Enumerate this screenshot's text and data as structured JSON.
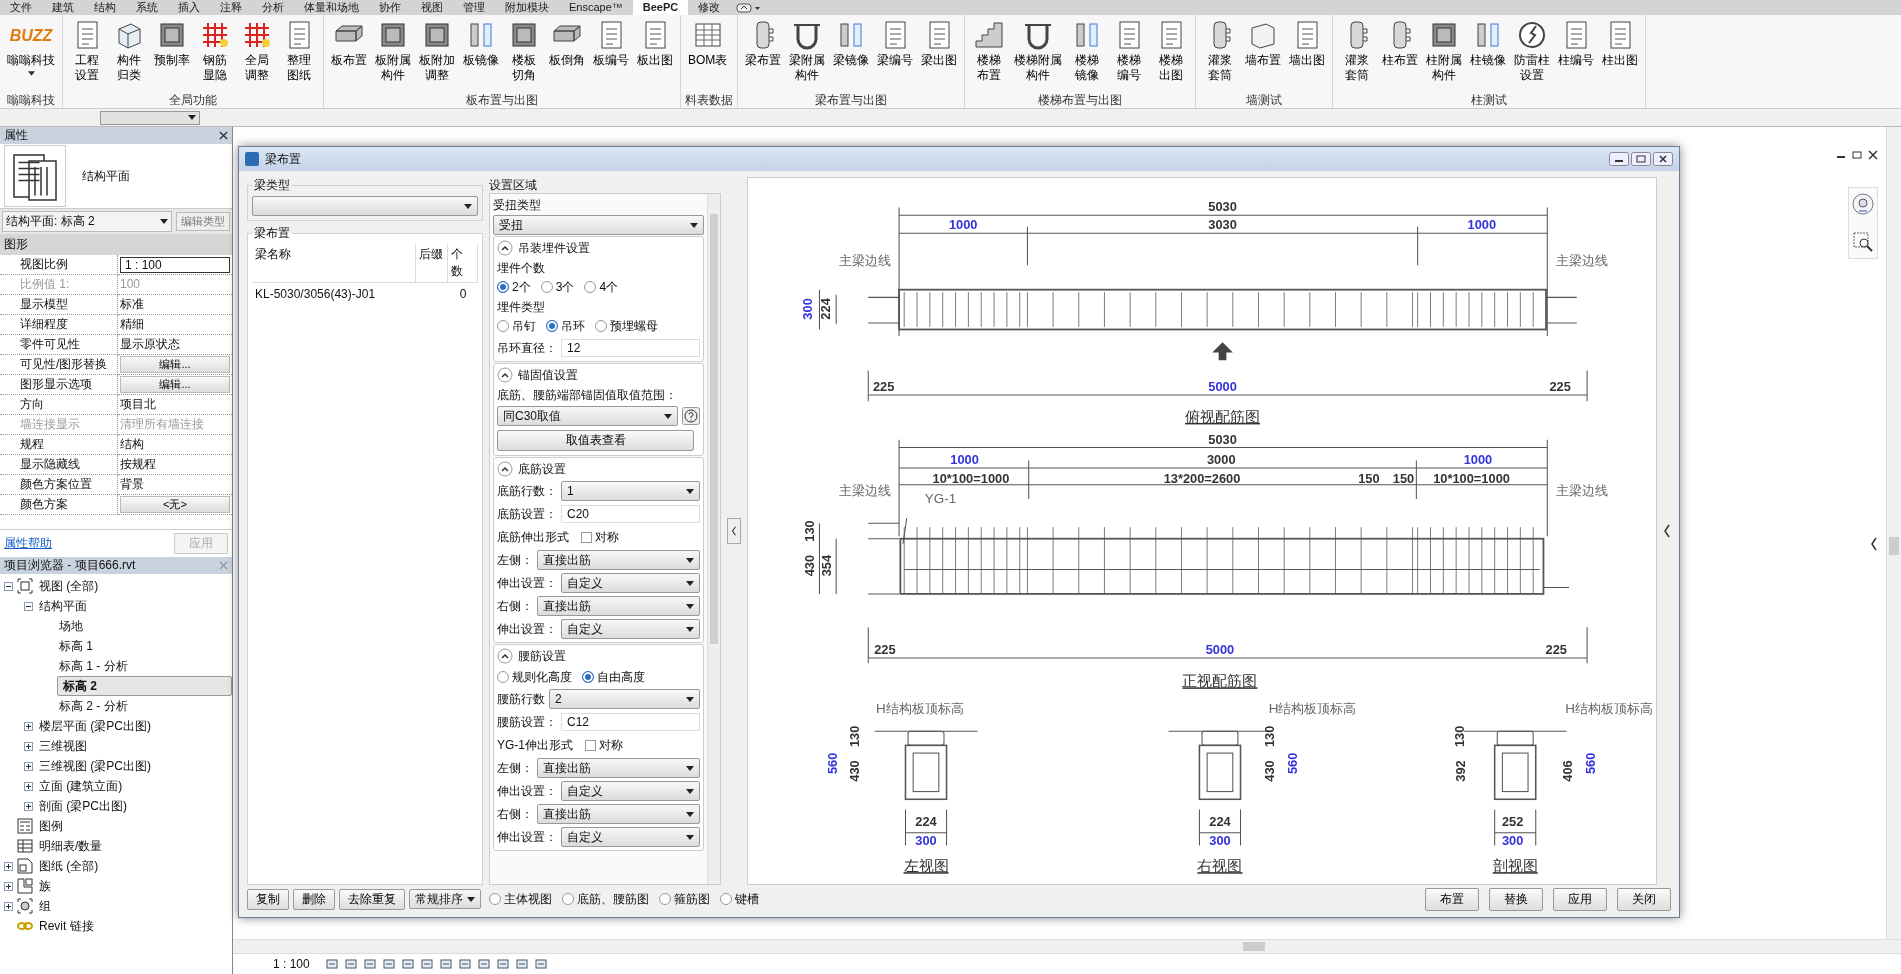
{
  "tabs": [
    {
      "label": "文件",
      "selected": false
    },
    {
      "label": "建筑",
      "selected": false
    },
    {
      "label": "结构",
      "selected": false
    },
    {
      "label": "系统",
      "selected": false
    },
    {
      "label": "插入",
      "selected": false
    },
    {
      "label": "注释",
      "selected": false
    },
    {
      "label": "分析",
      "selected": false
    },
    {
      "label": "体量和场地",
      "selected": false
    },
    {
      "label": "协作",
      "selected": false
    },
    {
      "label": "视图",
      "selected": false
    },
    {
      "label": "管理",
      "selected": false
    },
    {
      "label": "附加模块",
      "selected": false
    },
    {
      "label": "Enscape™",
      "selected": false
    },
    {
      "label": "BeePC",
      "selected": true
    },
    {
      "label": "修改",
      "selected": false
    }
  ],
  "ribbon": {
    "groups": [
      {
        "label": "嗡嗡科技",
        "buttons": [
          {
            "lines": [
              "嗡嗡科技"
            ],
            "logo": "BUZZ"
          }
        ]
      },
      {
        "label": "全局功能",
        "buttons": [
          {
            "lines": [
              "工程",
              "设置"
            ]
          },
          {
            "lines": [
              "构件",
              "归类"
            ]
          },
          {
            "lines": [
              "预制率"
            ]
          },
          {
            "lines": [
              "钢筋",
              "显隐"
            ]
          },
          {
            "lines": [
              "全局",
              "调整"
            ]
          },
          {
            "lines": [
              "整理",
              "图纸"
            ]
          }
        ]
      },
      {
        "label": "板布置与出图",
        "buttons": [
          {
            "lines": [
              "板布置"
            ]
          },
          {
            "lines": [
              "板附属",
              "构件"
            ]
          },
          {
            "lines": [
              "板附加",
              "调整"
            ]
          },
          {
            "lines": [
              "板镜像"
            ]
          },
          {
            "lines": [
              "楼板",
              "切角"
            ]
          },
          {
            "lines": [
              "板倒角"
            ]
          },
          {
            "lines": [
              "板编号"
            ]
          },
          {
            "lines": [
              "板出图"
            ]
          }
        ]
      },
      {
        "label": "料表数据",
        "buttons": [
          {
            "lines": [
              "BOM表"
            ]
          }
        ]
      },
      {
        "label": "梁布置与出图",
        "buttons": [
          {
            "lines": [
              "梁布置"
            ]
          },
          {
            "lines": [
              "梁附属",
              "构件"
            ]
          },
          {
            "lines": [
              "梁镜像"
            ]
          },
          {
            "lines": [
              "梁编号"
            ]
          },
          {
            "lines": [
              "梁出图"
            ]
          }
        ]
      },
      {
        "label": "楼梯布置与出图",
        "buttons": [
          {
            "lines": [
              "楼梯",
              "布置"
            ]
          },
          {
            "lines": [
              "楼梯附属",
              "构件"
            ]
          },
          {
            "lines": [
              "楼梯",
              "镜像"
            ]
          },
          {
            "lines": [
              "楼梯",
              "编号"
            ]
          },
          {
            "lines": [
              "楼梯",
              "出图"
            ]
          }
        ]
      },
      {
        "label": "墙测试",
        "buttons": [
          {
            "lines": [
              "灌浆",
              "套筒"
            ]
          },
          {
            "lines": [
              "墙布置"
            ]
          },
          {
            "lines": [
              "墙出图"
            ]
          }
        ]
      },
      {
        "label": "柱测试",
        "buttons": [
          {
            "lines": [
              "灌浆",
              "套筒"
            ]
          },
          {
            "lines": [
              "柱布置"
            ]
          },
          {
            "lines": [
              "柱附属",
              "构件"
            ]
          },
          {
            "lines": [
              "柱镜像"
            ]
          },
          {
            "lines": [
              "防雷柱",
              "设置"
            ]
          },
          {
            "lines": [
              "柱编号"
            ]
          },
          {
            "lines": [
              "柱出图"
            ]
          }
        ]
      }
    ]
  },
  "properties": {
    "title": "属性",
    "type_name": "结构平面",
    "selector": "结构平面: 标高 2",
    "edit_type": "编辑类型",
    "category": "图形",
    "rows": [
      {
        "name": "视图比例",
        "value": "1 : 100",
        "kind": "field",
        "disabled": false
      },
      {
        "name": "比例值 1:",
        "value": "100",
        "kind": "text",
        "disabled": true
      },
      {
        "name": "显示模型",
        "value": "标准",
        "kind": "text",
        "disabled": false
      },
      {
        "name": "详细程度",
        "value": "精细",
        "kind": "text",
        "disabled": false
      },
      {
        "name": "零件可见性",
        "value": "显示原状态",
        "kind": "text",
        "disabled": false
      },
      {
        "name": "可见性/图形替换",
        "value": "编辑...",
        "kind": "button",
        "disabled": false
      },
      {
        "name": "图形显示选项",
        "value": "编辑...",
        "kind": "button",
        "disabled": false
      },
      {
        "name": "方向",
        "value": "项目北",
        "kind": "text",
        "disabled": false
      },
      {
        "name": "墙连接显示",
        "value": "清理所有墙连接",
        "kind": "text",
        "disabled": true
      },
      {
        "name": "规程",
        "value": "结构",
        "kind": "text",
        "disabled": false
      },
      {
        "name": "显示隐藏线",
        "value": "按规程",
        "kind": "text",
        "disabled": false
      },
      {
        "name": "颜色方案位置",
        "value": "背景",
        "kind": "text",
        "disabled": false
      },
      {
        "name": "颜色方案",
        "value": "<无>",
        "kind": "button",
        "disabled": false
      }
    ],
    "help_link": "属性帮助",
    "apply": {
      "label": "应用",
      "disabled": true
    }
  },
  "browser": {
    "title": "项目浏览器 - 项目666.rvt",
    "tree": [
      {
        "label": "视图 (全部)",
        "expanded": true,
        "selected": false,
        "children": [
          {
            "label": "结构平面",
            "expanded": true,
            "selected": false,
            "children": [
              {
                "label": "场地",
                "selected": false
              },
              {
                "label": "标高 1",
                "selected": false
              },
              {
                "label": "标高 1 - 分析",
                "selected": false
              },
              {
                "label": "标高 2",
                "selected": true
              },
              {
                "label": "标高 2 - 分析",
                "selected": false
              }
            ]
          },
          {
            "label": "楼层平面 (梁PC出图)",
            "expanded": false,
            "selected": false
          },
          {
            "label": "三维视图",
            "expanded": false,
            "selected": false
          },
          {
            "label": "三维视图 (梁PC出图)",
            "expanded": false,
            "selected": false
          },
          {
            "label": "立面 (建筑立面)",
            "expanded": false,
            "selected": false
          },
          {
            "label": "剖面 (梁PC出图)",
            "expanded": false,
            "selected": false
          }
        ]
      },
      {
        "label": "图例",
        "selected": false
      },
      {
        "label": "明细表/数量",
        "selected": false
      },
      {
        "label": "图纸 (全部)",
        "expanded": false,
        "selected": false
      },
      {
        "label": "族",
        "expanded": false,
        "selected": false
      },
      {
        "label": "组",
        "expanded": false,
        "selected": false
      },
      {
        "label": "Revit 链接",
        "selected": false
      }
    ]
  },
  "view_scale": "1 : 100",
  "dialog": {
    "title": "梁布置",
    "beam_type_label": "梁类型",
    "layout_label": "梁布置",
    "columns": [
      "梁名称",
      "后缀",
      "个数"
    ],
    "rows": [
      {
        "name": "KL-5030/3056(43)-J01",
        "count": "0"
      }
    ],
    "left_buttons": [
      "复制",
      "删除",
      "去除重复"
    ],
    "sort": "常规排序",
    "settings": {
      "title": "设置区域",
      "torsion_label": "受扭类型",
      "torsion_value": "受扭",
      "sections": [
        {
          "title": "吊装埋件设置",
          "expanded": true,
          "items": [
            {
              "kind": "radios",
              "label": "埋件个数",
              "options": [
                {
                  "label": "2个",
                  "selected": true
                },
                {
                  "label": "3个",
                  "selected": false
                },
                {
                  "label": "4个",
                  "selected": false
                }
              ]
            },
            {
              "kind": "radios",
              "label": "埋件类型",
              "options": [
                {
                  "label": "吊钉",
                  "selected": false
                },
                {
                  "label": "吊环",
                  "selected": true
                },
                {
                  "label": "预埋螺母",
                  "selected": false
                }
              ]
            },
            {
              "kind": "field",
              "label": "吊环直径：",
              "value": "12"
            }
          ]
        },
        {
          "title": "锚固值设置",
          "expanded": true,
          "items": [
            {
              "kind": "note",
              "label": "底筋、腰筋端部锚固值取值范围："
            },
            {
              "kind": "select_help",
              "value": "同C30取值"
            },
            {
              "kind": "button",
              "label": "取值表查看"
            }
          ]
        },
        {
          "title": "底筋设置",
          "expanded": true,
          "items": [
            {
              "kind": "select",
              "label": "底筋行数：",
              "value": "1"
            },
            {
              "kind": "field",
              "label": "底筋设置：",
              "value": "C20"
            },
            {
              "kind": "check",
              "label": "底筋伸出形式",
              "option": "对称",
              "checked": false
            },
            {
              "kind": "select",
              "label": "左侧：",
              "value": "直接出筋"
            },
            {
              "kind": "select",
              "label": "伸出设置：",
              "value": "自定义"
            },
            {
              "kind": "select",
              "label": "右侧：",
              "value": "直接出筋"
            },
            {
              "kind": "select",
              "label": "伸出设置：",
              "value": "自定义"
            }
          ]
        },
        {
          "title": "腰筋设置",
          "expanded": true,
          "items": [
            {
              "kind": "radios",
              "options": [
                {
                  "label": "规则化高度",
                  "selected": false
                },
                {
                  "label": "自由高度",
                  "selected": true
                }
              ]
            },
            {
              "kind": "select",
              "label": "腰筋行数",
              "value": "2"
            },
            {
              "kind": "field",
              "label": "腰筋设置：",
              "value": "C12"
            },
            {
              "kind": "check",
              "label": "YG-1伸出形式",
              "option": "对称",
              "checked": false
            },
            {
              "kind": "select",
              "label": "左侧：",
              "value": "直接出筋"
            },
            {
              "kind": "select",
              "label": "伸出设置：",
              "value": "自定义"
            },
            {
              "kind": "select",
              "label": "右侧：",
              "value": "直接出筋"
            },
            {
              "kind": "select",
              "label": "伸出设置：",
              "value": "自定义"
            }
          ]
        }
      ]
    },
    "view_options": [
      {
        "label": "主体视图",
        "selected": false
      },
      {
        "label": "底筋、腰筋图",
        "selected": false
      },
      {
        "label": "箍筋图",
        "selected": false
      },
      {
        "label": "键槽",
        "selected": false
      }
    ],
    "actions": [
      "布置",
      "替换",
      "应用",
      "关闭"
    ],
    "preview": {
      "top": {
        "title": "俯视配筋图",
        "edge_labels": [
          "主梁边线",
          "主梁边线"
        ],
        "dims": [
          {
            "text": "5030",
            "color": "#333333"
          },
          {
            "text": "1000",
            "color": "#3333dd"
          },
          {
            "text": "3030",
            "color": "#333333"
          },
          {
            "text": "1000",
            "color": "#3333dd"
          },
          {
            "text": "300",
            "color": "#3333dd"
          },
          {
            "text": "224",
            "color": "#333333"
          },
          {
            "text": "225",
            "color": "#333333"
          },
          {
            "text": "5000",
            "color": "#3333dd"
          },
          {
            "text": "225",
            "color": "#333333"
          }
        ]
      },
      "front": {
        "title": "正视配筋图",
        "bar_label": "YG-1",
        "edge_labels": [
          "主梁边线",
          "主梁边线"
        ],
        "dims": [
          {
            "text": "5030",
            "color": "#333333"
          },
          {
            "text": "1000",
            "color": "#3333dd"
          },
          {
            "text": "3000",
            "color": "#333333"
          },
          {
            "text": "1000",
            "color": "#3333dd"
          },
          {
            "text": "10*100=1000",
            "color": "#333333"
          },
          {
            "text": "13*200=2600",
            "color": "#333333"
          },
          {
            "text": "150",
            "color": "#333333"
          },
          {
            "text": "150",
            "color": "#333333"
          },
          {
            "text": "10*100=1000",
            "color": "#333333"
          },
          {
            "text": "130",
            "color": "#333333"
          },
          {
            "text": "430",
            "color": "#333333"
          },
          {
            "text": "354",
            "color": "#333333"
          },
          {
            "text": "225",
            "color": "#333333"
          },
          {
            "text": "5000",
            "color": "#3333dd"
          },
          {
            "text": "225",
            "color": "#333333"
          }
        ]
      },
      "sections": [
        {
          "label": "H结构板顶标高",
          "title": "左视图",
          "dims": [
            {
              "text": "560",
              "color": "#3333dd"
            },
            {
              "text": "130",
              "color": "#333333"
            },
            {
              "text": "430",
              "color": "#333333"
            },
            {
              "text": "224",
              "color": "#333333"
            },
            {
              "text": "300",
              "color": "#3333dd"
            }
          ]
        },
        {
          "label": "H结构板顶标高",
          "title": "右视图",
          "dims": [
            {
              "text": "130",
              "color": "#333333"
            },
            {
              "text": "430",
              "color": "#333333"
            },
            {
              "text": "560",
              "color": "#3333dd"
            },
            {
              "text": "224",
              "color": "#333333"
            },
            {
              "text": "300",
              "color": "#3333dd"
            }
          ]
        },
        {
          "label": "H结构板顶标高",
          "title": "剖视图",
          "dims": [
            {
              "text": "130",
              "color": "#333333"
            },
            {
              "text": "392",
              "color": "#333333"
            },
            {
              "text": "406",
              "color": "#333333"
            },
            {
              "text": "560",
              "color": "#3333dd"
            },
            {
              "text": "252",
              "color": "#333333"
            },
            {
              "text": "300",
              "color": "#3333dd"
            }
          ]
        }
      ]
    }
  }
}
